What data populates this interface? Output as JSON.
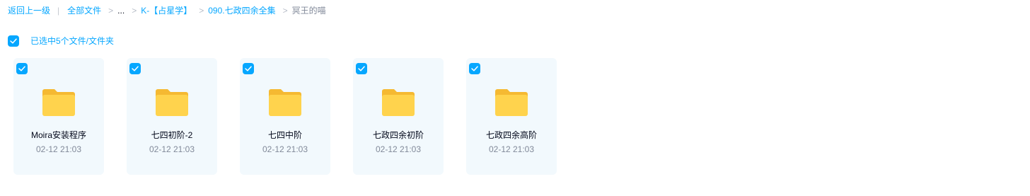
{
  "breadcrumb": {
    "back": "返回上一级",
    "all_files": "全部文件",
    "ellipsis": "...",
    "level1": "K-【占星学】",
    "level2": "090.七政四余全集",
    "current": "冥王的喵",
    "separator": ">",
    "divider": "|"
  },
  "selection": {
    "text": "已选中5个文件/文件夹",
    "checked": true
  },
  "files": [
    {
      "name": "Moira安装程序",
      "date": "02-12 21:03",
      "checked": true,
      "icon": "folder-icon"
    },
    {
      "name": "七四初阶-2",
      "date": "02-12 21:03",
      "checked": true,
      "icon": "folder-icon"
    },
    {
      "name": "七四中阶",
      "date": "02-12 21:03",
      "checked": true,
      "icon": "folder-icon"
    },
    {
      "name": "七政四余初阶",
      "date": "02-12 21:03",
      "checked": true,
      "icon": "folder-icon"
    },
    {
      "name": "七政四余高阶",
      "date": "02-12 21:03",
      "checked": true,
      "icon": "folder-icon"
    }
  ],
  "colors": {
    "accent": "#06a7ff",
    "card_bg": "#f2f9fd",
    "folder_back": "#f5b932",
    "folder_front": "#ffd34d",
    "text_primary": "#03081a",
    "text_secondary": "#818999"
  }
}
